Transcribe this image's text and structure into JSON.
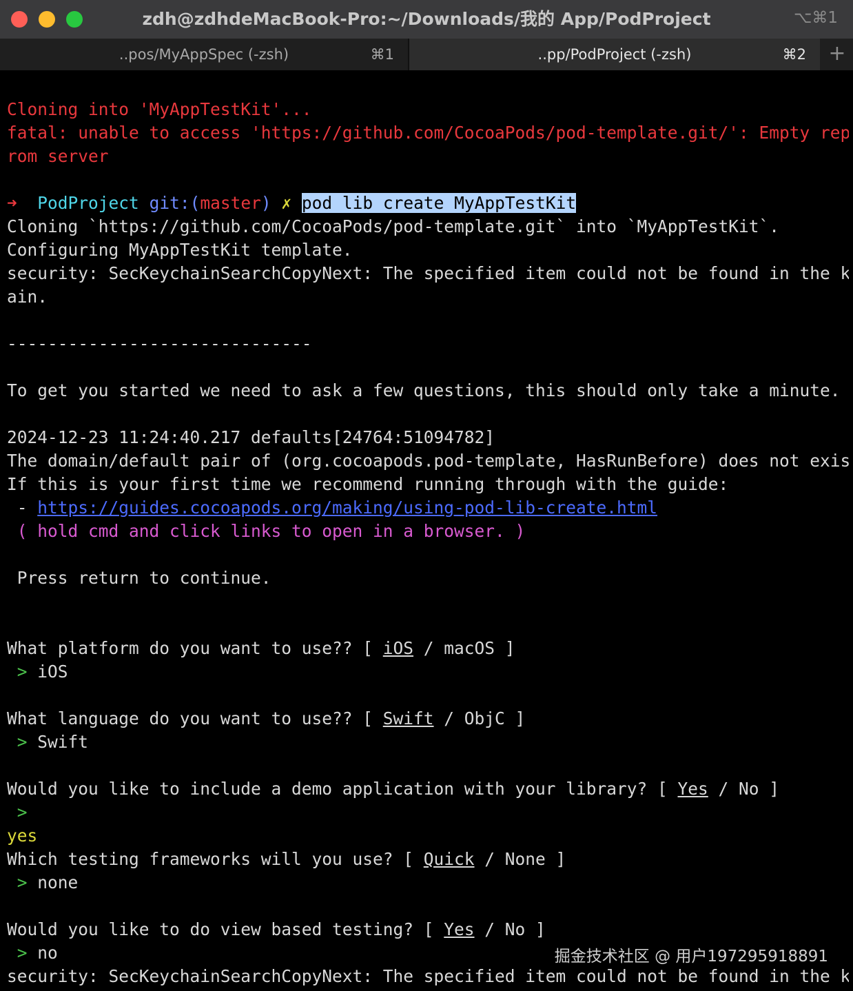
{
  "window": {
    "title": "zdh@zdhdeMacBook-Pro:~/Downloads/我的 App/PodProject",
    "shortcut": "⌥⌘1"
  },
  "tabs": [
    {
      "label": "..pos/MyAppSpec (-zsh)",
      "shortcut": "⌘1",
      "active": false
    },
    {
      "label": "..pp/PodProject (-zsh)",
      "shortcut": "⌘2",
      "active": true
    }
  ],
  "new_tab_label": "+",
  "terminal": {
    "clone_msg": "Cloning into 'MyAppTestKit'...",
    "fatal_1": "fatal: unable to access 'https://github.com/CocoaPods/pod-template.git/': Empty reply f",
    "fatal_2": "rom server",
    "prompt_arrow": "➜",
    "prompt_dir": "PodProject",
    "prompt_git": "git:(",
    "prompt_branch": "master",
    "prompt_git_close": ")",
    "prompt_dirty": "✗",
    "command": "pod lib create MyAppTestKit",
    "out_cloning": "Cloning `https://github.com/CocoaPods/pod-template.git` into `MyAppTestKit`.",
    "out_configuring": "Configuring MyAppTestKit template.",
    "security_1": "security: SecKeychainSearchCopyNext: The specified item could not be found in the keych",
    "security_2": "ain.",
    "separator": "------------------------------",
    "intro": "To get you started we need to ask a few questions, this should only take a minute.",
    "timestamp": "2024-12-23 11:24:40.217 defaults[24764:51094782]",
    "domain_msg": "The domain/default pair of (org.cocoapods.pod-template, HasRunBefore) does not exist",
    "guide_msg": "If this is your first time we recommend running through with the guide:",
    "guide_dash": " - ",
    "guide_link": "https://guides.cocoapods.org/making/using-pod-lib-create.html",
    "hold_cmd": " ( hold cmd and click links to open in a browser. )",
    "press_return": " Press return to continue.",
    "q_platform_pre": "What platform do you want to use?? [ ",
    "q_platform_default": "iOS",
    "q_platform_post": " / macOS ]",
    "a_platform": "iOS",
    "q_language_pre": "What language do you want to use?? [ ",
    "q_language_default": "Swift",
    "q_language_post": " / ObjC ]",
    "a_language": "Swift",
    "q_demo_pre": "Would you like to include a demo application with your library? [ ",
    "q_demo_default": "Yes",
    "q_demo_post": " / No ]",
    "a_demo": "yes",
    "q_testing_pre": "Which testing frameworks will you use? [ ",
    "q_testing_default": "Quick",
    "q_testing_post": " / None ]",
    "a_testing": "none",
    "q_view_pre": "Would you like to do view based testing? [ ",
    "q_view_default": "Yes",
    "q_view_post": " / No ]",
    "a_view": "no",
    "input_marker": " > ",
    "security_last": "security: SecKeychainSearchCopyNext: The specified item could not be found in the keych"
  },
  "watermark": "掘金技术社区 @ 用户197295918891",
  "colors": {
    "error": "#e8383d",
    "prompt_dir": "#4fd6e8",
    "prompt_git": "#6f8bff",
    "branch": "#e8383d",
    "dirty": "#dcd93a",
    "link": "#4c6bff",
    "hint": "#d85ad0",
    "answer_marker": "#4cc34c",
    "selection": "#b3d4fc"
  }
}
